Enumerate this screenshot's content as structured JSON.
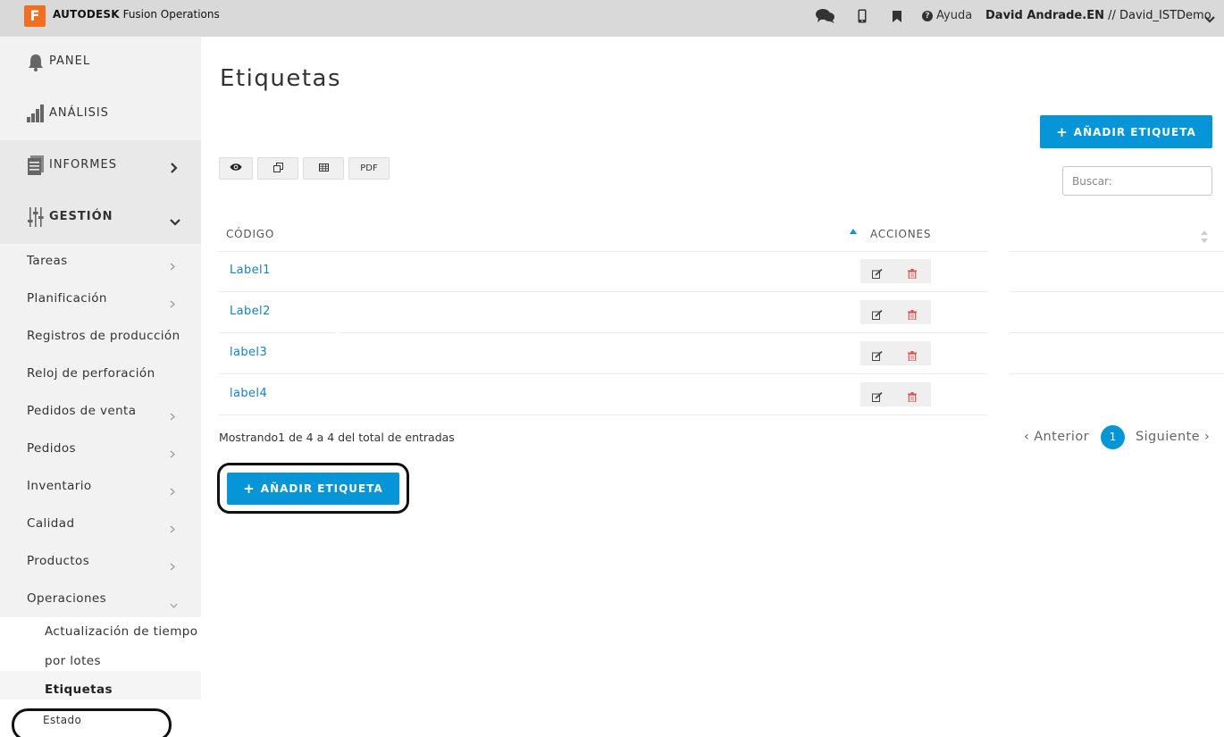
{
  "topbar": {
    "logo_letter": "F",
    "brand_strong": "AUTODESK",
    "brand_rest": "Fusion Operations",
    "help_label": "Ayuda",
    "help_icon": "?",
    "user_name": "David Andrade.EN",
    "user_org": " // David_ISTDemo",
    "icons": [
      "chat-icon",
      "mobile-icon",
      "bookmark-icon",
      "help-icon",
      "chevron-down-icon"
    ]
  },
  "sidebar": {
    "main": [
      {
        "label": "PANEL",
        "icon": "bell-icon"
      },
      {
        "label": "ANÁLISIS",
        "icon": "bar-chart-icon"
      },
      {
        "label": "INFORMES",
        "icon": "document-icon"
      },
      {
        "label": "GESTIÓN",
        "icon": "sliders-icon"
      }
    ],
    "sub": [
      {
        "label": "Tareas"
      },
      {
        "label": "Planificación"
      },
      {
        "label": "Registros de producción"
      },
      {
        "label": "Reloj de perforación"
      },
      {
        "label": "Pedidos de venta"
      },
      {
        "label": "Pedidos"
      },
      {
        "label": "Inventario"
      },
      {
        "label": "Calidad"
      },
      {
        "label": "Productos"
      },
      {
        "label": "Operaciones"
      }
    ],
    "ops": [
      {
        "label": "Actualización de tiempo"
      },
      {
        "label": "por lotes"
      },
      {
        "label": "Etiquetas"
      },
      {
        "label": "Estado"
      }
    ]
  },
  "main": {
    "title": "Etiquetas",
    "add_button_label": "AÑADIR ETIQUETA",
    "add_button_icon": "+",
    "toolbar": {
      "pdf_label": "PDF"
    },
    "search_placeholder": "Buscar:",
    "columns": {
      "code": "CÓDIGO",
      "actions": "ACCIONES"
    },
    "rows": [
      {
        "code": "Label1"
      },
      {
        "code": "Label2"
      },
      {
        "code": "label3"
      },
      {
        "code": "label4"
      }
    ],
    "info": "Mostrando1 de 4 a 4 del total de entradas",
    "pager": {
      "prev": "‹ Anterior",
      "next": "Siguiente ›",
      "current": "1"
    }
  },
  "colors": {
    "accent": "#0696d7",
    "link": "#1a7fc1",
    "delete": "#d9534f",
    "logo": "#f26f21"
  }
}
